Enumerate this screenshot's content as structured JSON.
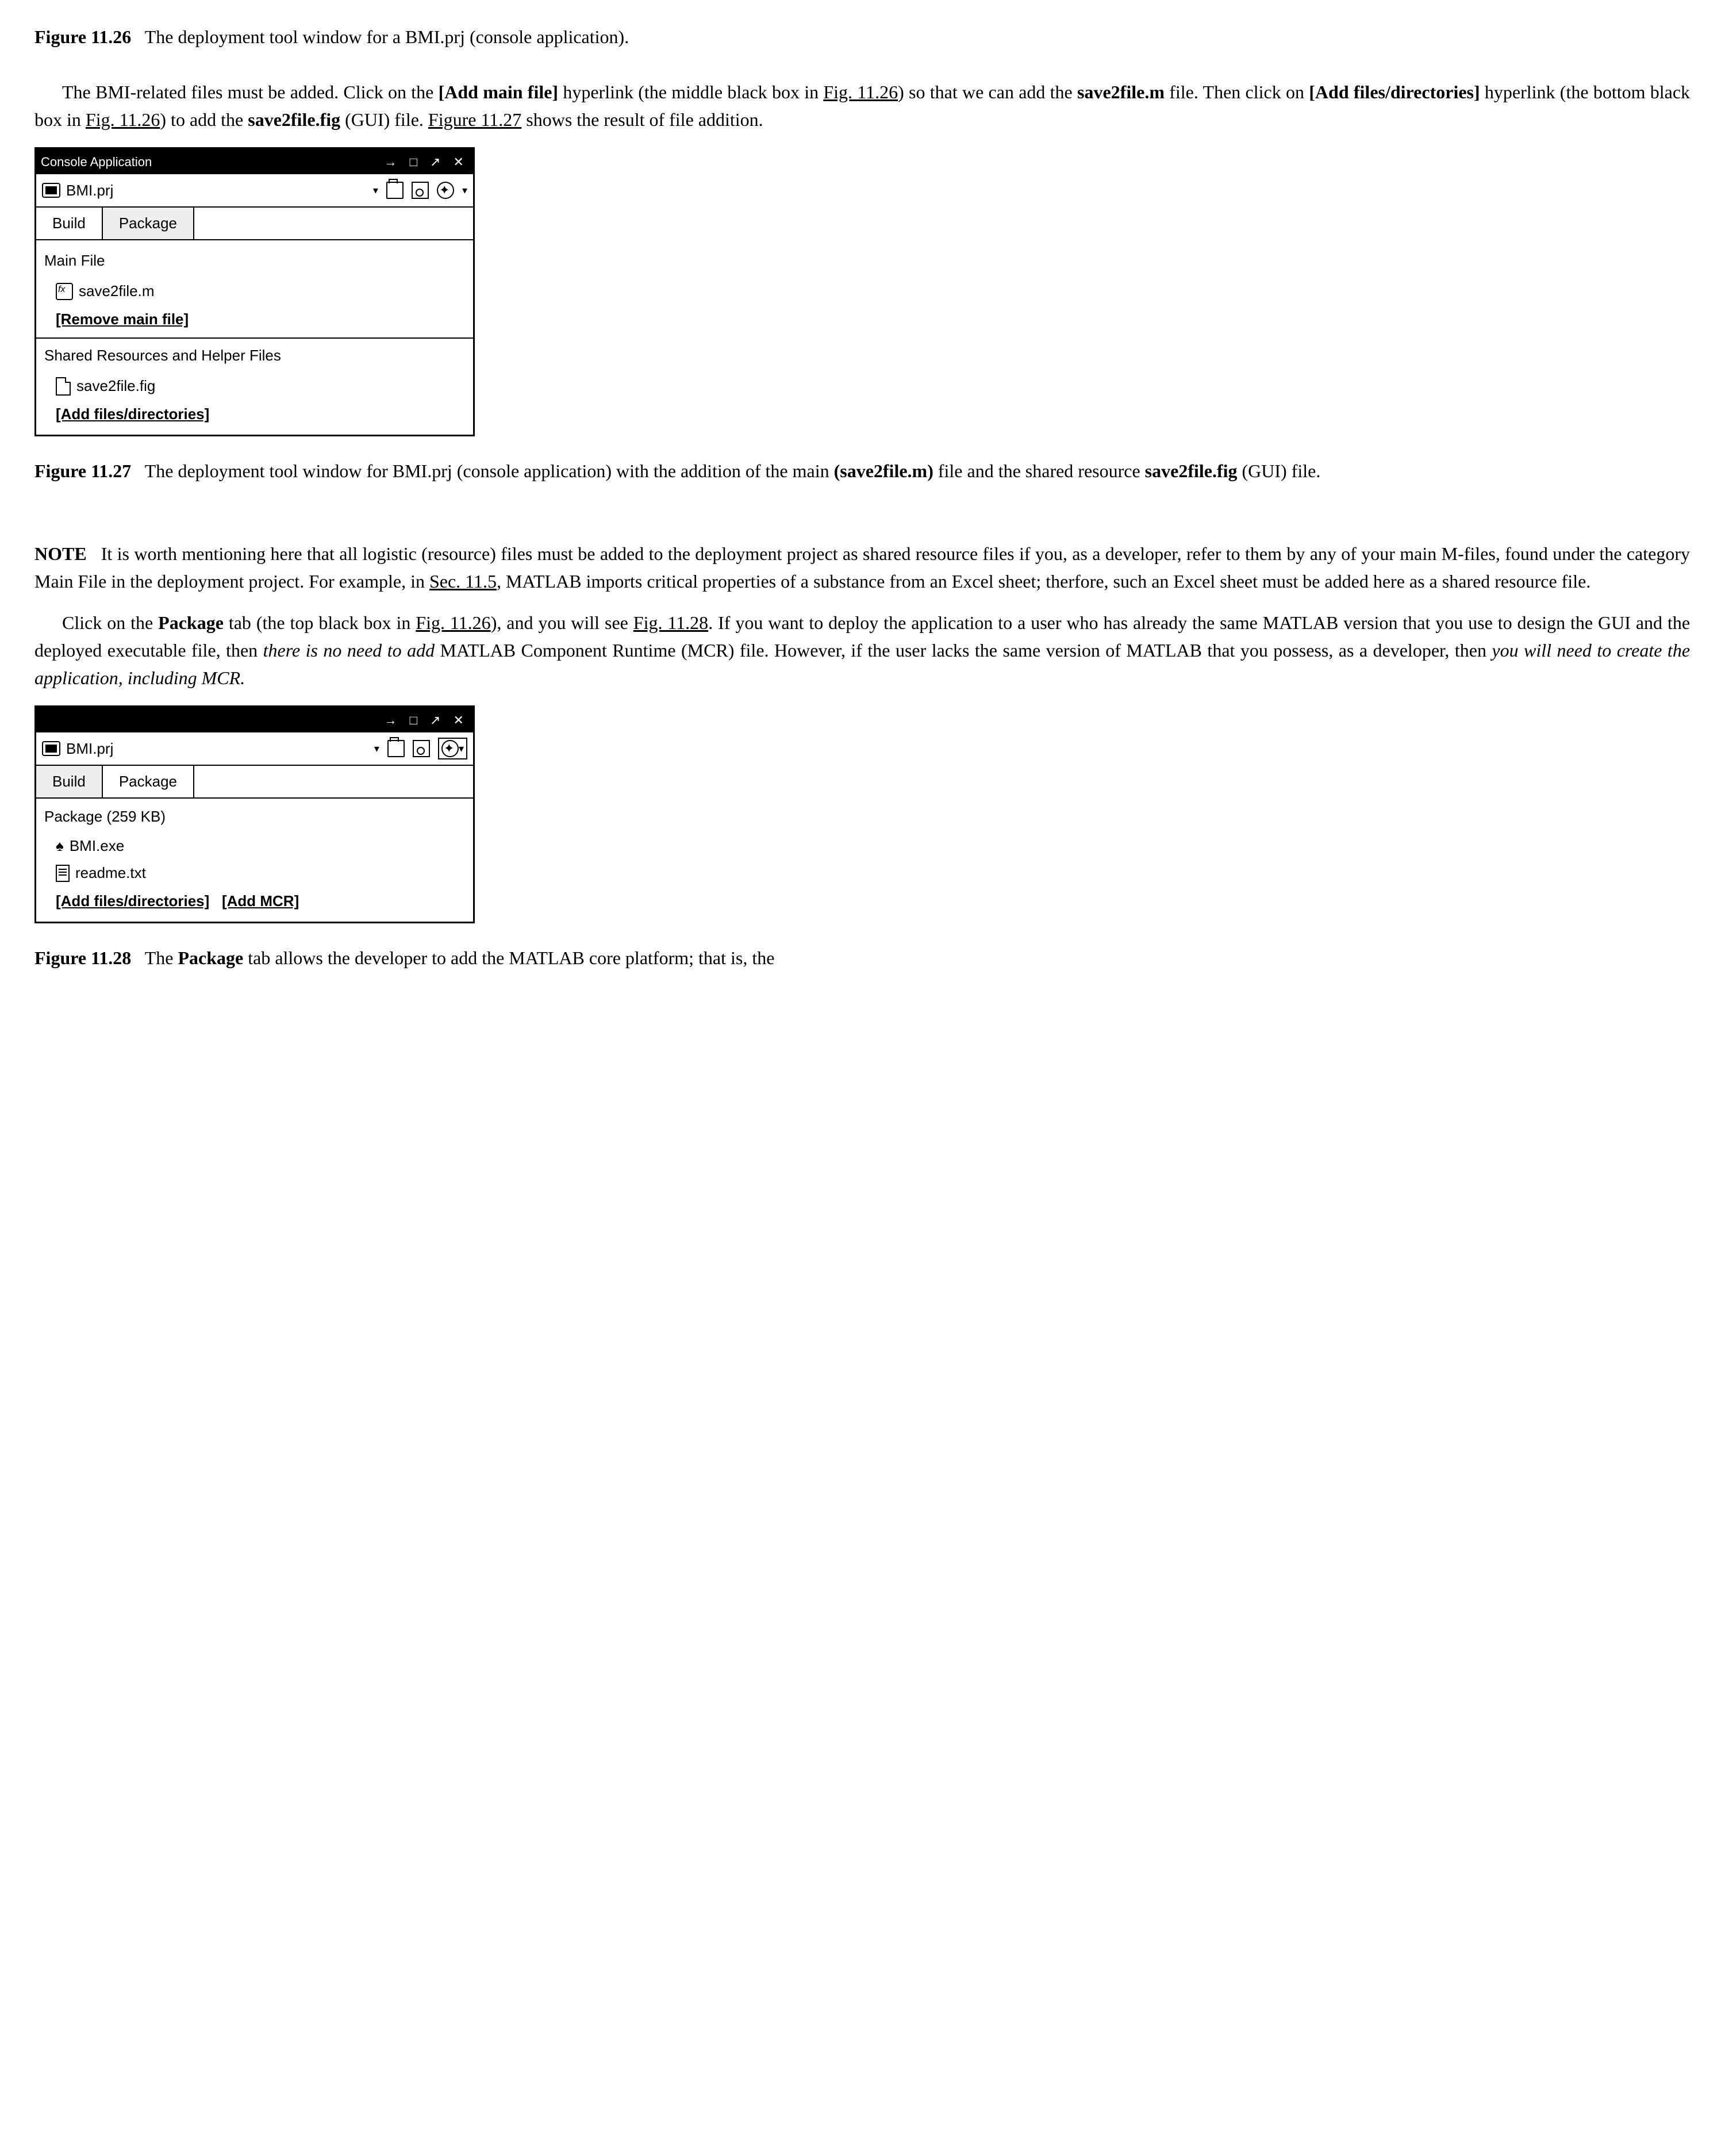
{
  "captions": {
    "fig26_label": "Figure 11.26",
    "fig26_text": "The deployment tool window for a BMI.prj (console application).",
    "fig27_label": "Figure 11.27",
    "fig27_text": "The deployment tool window for BMI.prj (console application) with the addition of the main (save2file.m) file and the shared resource save2file.fig (GUI) file.",
    "fig28_label": "Figure 11.28",
    "fig28_text": "The Package tab allows the developer to add the MATLAB core platform; that is, the"
  },
  "paragraphs": {
    "p1_a": "The BMI-related files must be added. Click on the ",
    "p1_b": "[Add main file]",
    "p1_c": " hyperlink (the middle black box in ",
    "p1_link1": "Fig. 11.26",
    "p1_d": ") so that we can add the ",
    "p1_e": "save2file.m",
    "p1_f": " file. Then click on ",
    "p1_g": "[Add files/directories]",
    "p1_h": " hyperlink (the bottom black box in ",
    "p1_link2": "Fig. 11.26",
    "p1_i": ") to add the ",
    "p1_j": "save2file.fig",
    "p1_k": " (GUI) file. ",
    "p1_link3": "Figure 11.27",
    "p1_l": " shows the result of file addition.",
    "note_label": "NOTE",
    "note_a": "It is worth mentioning here that all logistic (resource) files must be added to the deployment project as shared resource files if you, as a developer, refer to them by any of your main M-files, found under the category Main File in the deployment project. For example, in ",
    "note_link1": "Sec. 11.5",
    "note_b": ", MATLAB imports critical properties of a substance from an Excel sheet; therfore, such an Excel sheet must be added here as a shared resource file.",
    "p3_a": "Click on the ",
    "p3_b": "Package",
    "p3_c": " tab (the top black box in ",
    "p3_link1": "Fig. 11.26",
    "p3_d": "), and you will see ",
    "p3_link2": "Fig. 11.28",
    "p3_e": ". If you want to deploy the application to a user who has already the same MATLAB version that you use to design the GUI and the deployed executable file, then ",
    "p3_f": "there is no need to add",
    "p3_g": " MATLAB Component Runtime (MCR) file. However, if the user lacks the same version of MATLAB that you possess, as a developer, then ",
    "p3_h": "you will need to create the application, including MCR."
  },
  "window27": {
    "title": "Console Application",
    "controls": "→ □ ↗ ✕",
    "project": "BMI.prj",
    "dropdown": "▾",
    "tabBuild": "Build",
    "tabPackage": "Package",
    "mainFileHdr": "Main File",
    "mainFile": "save2file.m",
    "removeLink": "[Remove main file]",
    "sharedHdr": "Shared Resources and Helper Files",
    "sharedFile": "save2file.fig",
    "addFilesLink": "[Add files/directories]"
  },
  "window28": {
    "title": " ",
    "controls": "→ □ ↗ ✕",
    "project": "BMI.prj",
    "dropdown": "▾",
    "tabBuild": "Build",
    "tabPackage": "Package",
    "pkgSize": "Package (259 KB)",
    "exe": "BMI.exe",
    "readme": "readme.txt",
    "addFilesLink": "[Add files/directories]",
    "addMcrLink": "[Add MCR]"
  }
}
